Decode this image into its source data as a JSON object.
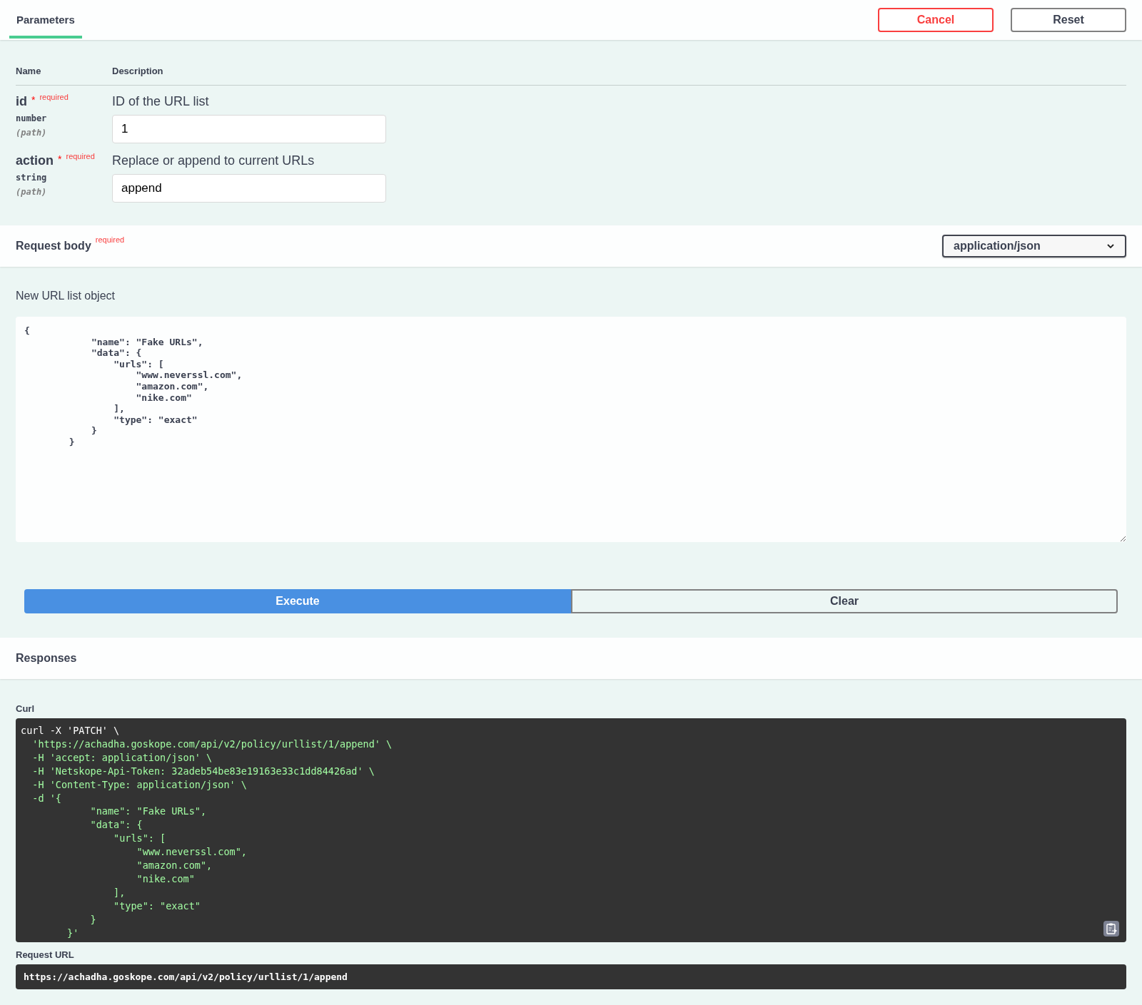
{
  "tabs": [
    {
      "label": "Parameters",
      "selected": true
    }
  ],
  "header_buttons": [
    {
      "label": "Cancel",
      "kind": "danger"
    },
    {
      "label": "Reset",
      "kind": "plain"
    }
  ],
  "parameters": {
    "columns": [
      "Name",
      "Description"
    ],
    "rows": [
      {
        "name": "id",
        "star": "*",
        "required": "required",
        "type": "number",
        "location": "(path)",
        "description": "ID of the URL list",
        "value": "1"
      },
      {
        "name": "action",
        "star": "*",
        "required": "required",
        "type": "string",
        "location": "(path)",
        "description": "Replace or append to current URLs",
        "value": "append"
      }
    ]
  },
  "request_body": {
    "title": "Request body",
    "required": "required",
    "content_type": "application/json",
    "description": "New URL list object",
    "value": "{\n            \"name\": \"Fake URLs\",\n            \"data\": {\n                \"urls\": [\n                    \"www.neverssl.com\",\n                    \"amazon.com\",\n                    \"nike.com\"\n                ],\n                \"type\": \"exact\"\n            }\n        }"
  },
  "actions": [
    {
      "label": "Execute",
      "kind": "primary"
    },
    {
      "label": "Clear",
      "kind": "outline"
    }
  ],
  "responses": {
    "title": "Responses",
    "curl": {
      "label": "Curl",
      "lines": [
        {
          "text": "curl -X 'PATCH' \\",
          "kind": "command"
        },
        {
          "text": "  'https://achadha.goskope.com/api/v2/policy/urllist/1/append' \\",
          "kind": "arg"
        },
        {
          "text": "  -H 'accept: application/json' \\",
          "kind": "arg"
        },
        {
          "text": "  -H 'Netskope-Api-Token: 32adeb54be83e19163e33c1dd84426ad' \\",
          "kind": "arg"
        },
        {
          "text": "  -H 'Content-Type: application/json' \\",
          "kind": "arg"
        },
        {
          "text": "  -d '{",
          "kind": "arg"
        },
        {
          "text": "            \"name\": \"Fake URLs\",",
          "kind": "arg"
        },
        {
          "text": "            \"data\": {",
          "kind": "arg"
        },
        {
          "text": "                \"urls\": [",
          "kind": "arg"
        },
        {
          "text": "                    \"www.neverssl.com\",",
          "kind": "arg"
        },
        {
          "text": "                    \"amazon.com\",",
          "kind": "arg"
        },
        {
          "text": "                    \"nike.com\"",
          "kind": "arg"
        },
        {
          "text": "                ],",
          "kind": "arg"
        },
        {
          "text": "                \"type\": \"exact\"",
          "kind": "arg"
        },
        {
          "text": "            }",
          "kind": "arg"
        },
        {
          "text": "        }'",
          "kind": "arg"
        }
      ]
    },
    "request_url": {
      "label": "Request URL",
      "value": "https://achadha.goskope.com/api/v2/policy/urllist/1/append"
    }
  }
}
